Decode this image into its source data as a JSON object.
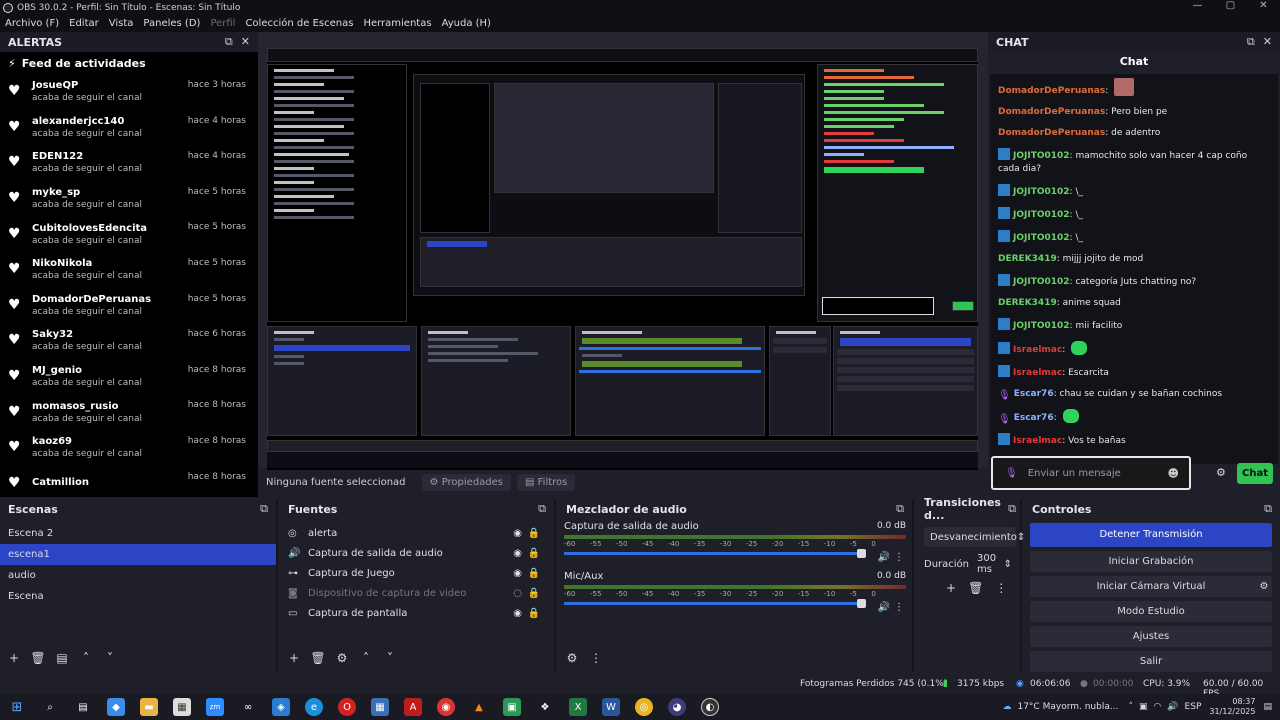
{
  "window": {
    "title": "OBS 30.0.2 - Perfil: Sin Título - Escenas: Sin Título",
    "controls": [
      "—",
      "▢",
      "✕"
    ]
  },
  "menu": [
    {
      "label": "Archivo (F)",
      "dim": false
    },
    {
      "label": "Editar",
      "dim": false
    },
    {
      "label": "Vista",
      "dim": false
    },
    {
      "label": "Paneles (D)",
      "dim": false
    },
    {
      "label": "Perfil",
      "dim": true
    },
    {
      "label": "Colección de Escenas",
      "dim": false
    },
    {
      "label": "Herramientas",
      "dim": false
    },
    {
      "label": "Ayuda (H)",
      "dim": false
    }
  ],
  "alerts": {
    "title": "ALERTAS",
    "feed_title": "Feed de actividades",
    "items": [
      {
        "user": "JosueQP",
        "action": "acaba de seguir el canal",
        "time": "hace 3 horas"
      },
      {
        "user": "alexanderjcc140",
        "action": "acaba de seguir el canal",
        "time": "hace 4 horas"
      },
      {
        "user": "EDEN122",
        "action": "acaba de seguir el canal",
        "time": "hace 4 horas"
      },
      {
        "user": "myke_sp",
        "action": "acaba de seguir el canal",
        "time": "hace 5 horas"
      },
      {
        "user": "CubitolovesEdencita",
        "action": "acaba de seguir el canal",
        "time": "hace 5 horas"
      },
      {
        "user": "NikoNikola",
        "action": "acaba de seguir el canal",
        "time": "hace 5 horas"
      },
      {
        "user": "DomadorDePeruanas",
        "action": "acaba de seguir el canal",
        "time": "hace 5 horas"
      },
      {
        "user": "Saky32",
        "action": "acaba de seguir el canal",
        "time": "hace 6 horas"
      },
      {
        "user": "MJ_genio",
        "action": "acaba de seguir el canal",
        "time": "hace 8 horas"
      },
      {
        "user": "momasos_rusio",
        "action": "acaba de seguir el canal",
        "time": "hace 8 horas"
      },
      {
        "user": "kaoz69",
        "action": "acaba de seguir el canal",
        "time": "hace 8 horas"
      },
      {
        "user": "Catmillion",
        "action": "",
        "time": "hace 8 horas"
      }
    ]
  },
  "source_bar": {
    "none_selected": "Ninguna fuente seleccionad",
    "properties": "Propiedades",
    "filters": "Filtros"
  },
  "chat": {
    "dock_title": "CHAT",
    "title": "Chat",
    "messages": [
      {
        "user": "DomadorDePeruanas",
        "text": "",
        "color": "#e06a3c",
        "badge": "none",
        "emote": "face"
      },
      {
        "user": "DomadorDePeruanas",
        "text": "Pero bien pe",
        "color": "#e06a3c",
        "badge": "none",
        "emote": ""
      },
      {
        "user": "DomadorDePeruanas",
        "text": "de adentro",
        "color": "#e06a3c",
        "badge": "none",
        "emote": ""
      },
      {
        "user": "JOJITO0102",
        "text": "mamochito solo van hacer 4 cap coño cada dia?",
        "color": "#6ad16a",
        "badge": "blue",
        "emote": ""
      },
      {
        "user": "JOJITO0102",
        "text": "\\_",
        "color": "#6ad16a",
        "badge": "blue",
        "emote": ""
      },
      {
        "user": "JOJITO0102",
        "text": "\\_",
        "color": "#6ad16a",
        "badge": "blue",
        "emote": ""
      },
      {
        "user": "JOJITO0102",
        "text": "\\_",
        "color": "#6ad16a",
        "badge": "blue",
        "emote": ""
      },
      {
        "user": "DEREK3419",
        "text": "mijjj jojito de mod",
        "color": "#6ad16a",
        "badge": "none",
        "emote": ""
      },
      {
        "user": "JOJITO0102",
        "text": "categoría Juts chatting no?",
        "color": "#6ad16a",
        "badge": "blue",
        "emote": ""
      },
      {
        "user": "DEREK3419",
        "text": "anime squad",
        "color": "#6ad16a",
        "badge": "none",
        "emote": ""
      },
      {
        "user": "JOJITO0102",
        "text": "mii facilito",
        "color": "#6ad16a",
        "badge": "blue",
        "emote": ""
      },
      {
        "user": "Israelmac",
        "text": "",
        "color": "#e23b3b",
        "badge": "blue",
        "emote": "green"
      },
      {
        "user": "Israelmac",
        "text": "Escarcita",
        "color": "#e23b3b",
        "badge": "blue",
        "emote": ""
      },
      {
        "user": "Escar76",
        "text": "chau se cuidan y se bañan cochinos",
        "color": "#8fb0ff",
        "badge": "mic",
        "emote": ""
      },
      {
        "user": "Escar76",
        "text": "",
        "color": "#8fb0ff",
        "badge": "mic",
        "emote": "green"
      },
      {
        "user": "Israelmac",
        "text": "Vos te bañas",
        "color": "#e23b3b",
        "badge": "blue",
        "emote": ""
      }
    ],
    "input_placeholder": "Enviar un mensaje",
    "send_label": "Chat"
  },
  "scenes": {
    "title": "Escenas",
    "items": [
      {
        "label": "Escena 2",
        "selected": false
      },
      {
        "label": "escena1",
        "selected": true
      },
      {
        "label": "audio",
        "selected": false
      },
      {
        "label": "Escena",
        "selected": false
      }
    ]
  },
  "sources": {
    "title": "Fuentes",
    "items": [
      {
        "label": "alerta",
        "icon": "globe-icon",
        "glyph": "◎",
        "dim": false
      },
      {
        "label": "Captura de salida de audio",
        "icon": "speaker-icon",
        "glyph": "🔊",
        "dim": false
      },
      {
        "label": "Captura de Juego",
        "icon": "gamepad-icon",
        "glyph": "⊶",
        "dim": false
      },
      {
        "label": "Dispositivo de captura de video",
        "icon": "camera-icon",
        "glyph": "◙",
        "dim": true
      },
      {
        "label": "Captura de pantalla",
        "icon": "monitor-icon",
        "glyph": "▭",
        "dim": false
      }
    ]
  },
  "mixer": {
    "title": "Mezclador de audio",
    "ticks": [
      "-60",
      "-55",
      "-50",
      "-45",
      "-40",
      "-35",
      "-30",
      "-25",
      "-20",
      "-15",
      "-10",
      "-5",
      "0"
    ],
    "channels": [
      {
        "name": "Captura de salida de audio",
        "db": "0.0 dB",
        "volume_percent": 100
      },
      {
        "name": "Mic/Aux",
        "db": "0.0 dB",
        "volume_percent": 100
      }
    ]
  },
  "transitions": {
    "title": "Transiciones d...",
    "type": "Desvanecimiento",
    "duration_label": "Duración",
    "duration_value": "300 ms"
  },
  "controls": {
    "title": "Controles",
    "buttons": [
      {
        "label": "Detener Transmisión",
        "primary": true
      },
      {
        "label": "Iniciar Grabación",
        "primary": false
      },
      {
        "label": "Iniciar Cámara Virtual",
        "primary": false
      },
      {
        "label": "Modo Estudio",
        "primary": false
      },
      {
        "label": "Ajustes",
        "primary": false
      },
      {
        "label": "Salir",
        "primary": false
      }
    ]
  },
  "status": {
    "dropped": "Fotogramas Perdidos 745 (0.1%)",
    "bitrate": "3175 kbps",
    "stream_time": "06:06:06",
    "rec_time": "00:00:00",
    "cpu": "CPU: 3.9%",
    "fps": "60.00 / 60.00 FPS"
  },
  "taskbar": {
    "weather": "17°C  Mayorm. nubla...",
    "lang": "ESP",
    "time": "08:37",
    "date": "31/12/2025"
  },
  "colors": {
    "accent": "#2b45c4",
    "chat_send": "#31c353",
    "panel_bg": "#1e1f29"
  }
}
